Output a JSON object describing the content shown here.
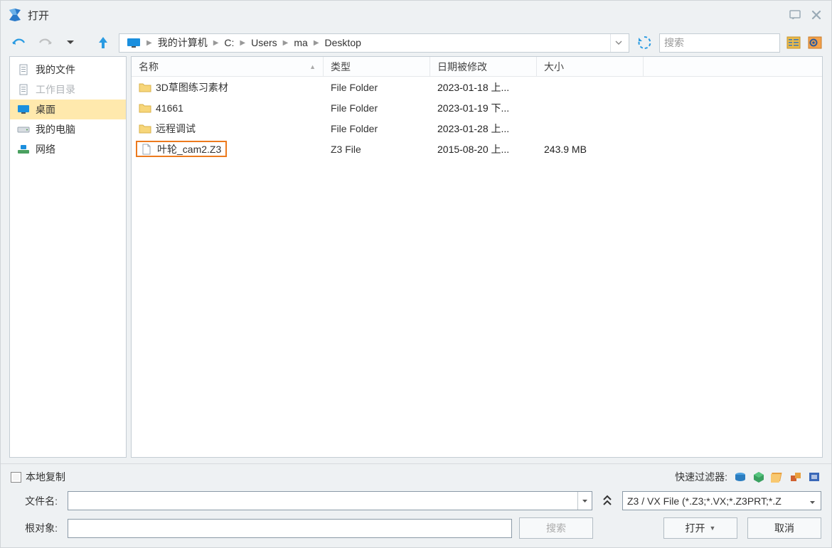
{
  "window": {
    "title": "打开"
  },
  "breadcrumb": {
    "root": "我的计算机",
    "segments": [
      "C:",
      "Users",
      "ma",
      "Desktop"
    ]
  },
  "search": {
    "placeholder": "搜索"
  },
  "sidebar": {
    "items": [
      {
        "label": "我的文件",
        "icon": "doc",
        "state": "normal"
      },
      {
        "label": "工作目录",
        "icon": "doc",
        "state": "disabled"
      },
      {
        "label": "桌面",
        "icon": "monitor",
        "state": "selected"
      },
      {
        "label": "我的电脑",
        "icon": "drive",
        "state": "normal"
      },
      {
        "label": "网络",
        "icon": "network",
        "state": "normal"
      }
    ]
  },
  "columns": {
    "name": "名称",
    "type": "类型",
    "date": "日期被修改",
    "size": "大小"
  },
  "files": [
    {
      "name": "3D草图练习素材",
      "type": "File Folder",
      "date": "2023-01-18 上...",
      "size": "",
      "icon": "folder",
      "highlight": false
    },
    {
      "name": "41661",
      "type": "File Folder",
      "date": "2023-01-19 下...",
      "size": "",
      "icon": "folder",
      "highlight": false
    },
    {
      "name": "远程调试",
      "type": "File Folder",
      "date": "2023-01-28 上...",
      "size": "",
      "icon": "folder",
      "highlight": false
    },
    {
      "name": "叶轮_cam2.Z3",
      "type": "Z3 File",
      "date": "2015-08-20 上...",
      "size": "243.9 MB",
      "icon": "file",
      "highlight": true
    }
  ],
  "footer": {
    "local_copy": "本地复制",
    "quick_filter_label": "快速过滤器:",
    "filename_label": "文件名:",
    "root_label": "根对象:",
    "filetype_value": "Z3 / VX File (*.Z3;*.VX;*.Z3PRT;*.Z",
    "search_btn": "搜索",
    "open_btn": "打开",
    "cancel_btn": "取消"
  }
}
